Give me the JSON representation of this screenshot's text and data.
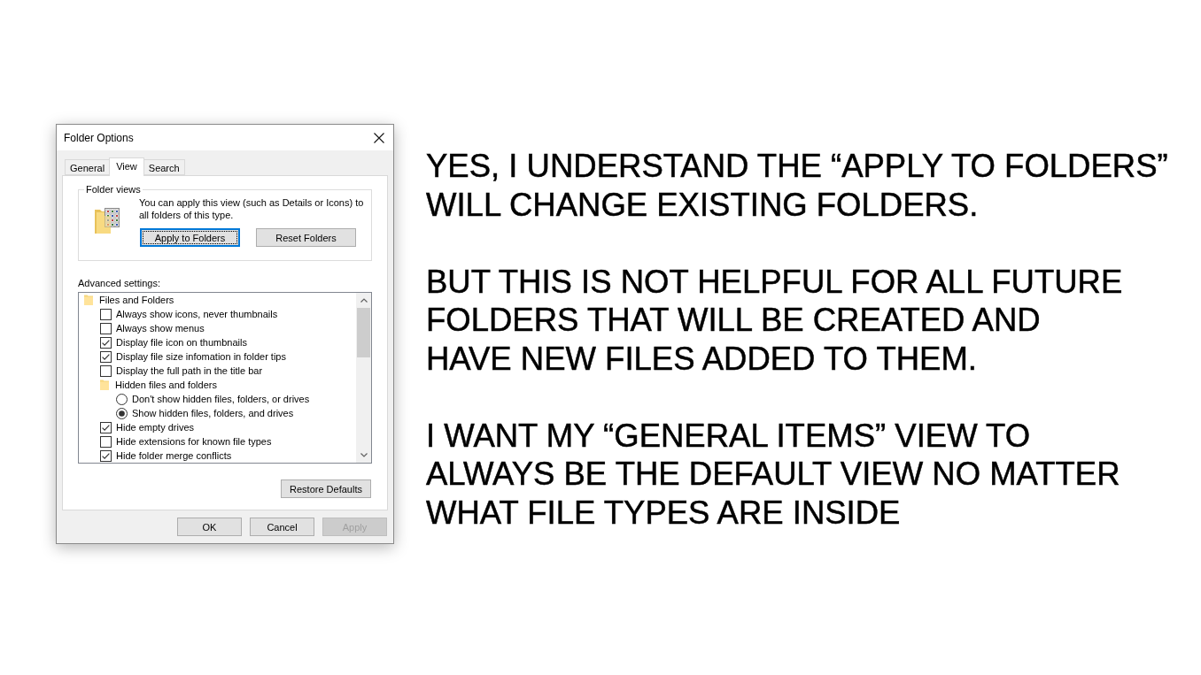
{
  "window": {
    "title": "Folder Options"
  },
  "tabs": [
    {
      "label": "General",
      "selected": false
    },
    {
      "label": "View",
      "selected": true
    },
    {
      "label": "Search",
      "selected": false
    }
  ],
  "folder_views": {
    "title": "Folder views",
    "description": "You can apply this view (such as Details or Icons) to all folders of this type.",
    "buttons": [
      {
        "label": "Apply to Folders",
        "focused": true
      },
      {
        "label": "Reset Folders",
        "focused": false
      }
    ]
  },
  "advanced_settings": {
    "label": "Advanced settings:",
    "items": [
      {
        "kind": "folder",
        "label": "Files and Folders",
        "children": [
          {
            "kind": "checkbox",
            "label": "Always show icons, never thumbnails",
            "checked": false
          },
          {
            "kind": "checkbox",
            "label": "Always show menus",
            "checked": false
          },
          {
            "kind": "checkbox",
            "label": "Display file icon on thumbnails",
            "checked": true
          },
          {
            "kind": "checkbox",
            "label": "Display file size infomation in folder tips",
            "checked": true
          },
          {
            "kind": "checkbox",
            "label": "Display the full path in the title bar",
            "checked": false
          },
          {
            "kind": "folder",
            "label": "Hidden files and folders",
            "children": [
              {
                "kind": "radio",
                "label": "Don't show hidden files, folders, or drives",
                "selected": false
              },
              {
                "kind": "radio",
                "label": "Show hidden files, folders, and drives",
                "selected": true
              }
            ]
          },
          {
            "kind": "checkbox",
            "label": "Hide empty drives",
            "checked": true
          },
          {
            "kind": "checkbox",
            "label": "Hide extensions for known file types",
            "checked": false
          },
          {
            "kind": "checkbox",
            "label": "Hide folder merge conflicts",
            "checked": true
          }
        ]
      }
    ],
    "restore_button": "Restore Defaults"
  },
  "dialog_buttons": [
    {
      "label": "OK",
      "disabled": false
    },
    {
      "label": "Cancel",
      "disabled": false
    },
    {
      "label": "Apply",
      "disabled": true
    }
  ],
  "caption": {
    "paragraphs": [
      {
        "lines": [
          "YES, I UNDERSTAND THE “APPLY TO FOLDERS”",
          "WILL CHANGE EXISTING FOLDERS."
        ]
      },
      {
        "lines": [
          "BUT THIS IS NOT HELPFUL FOR ALL FUTURE",
          "FOLDERS THAT WILL BE CREATED AND",
          "HAVE NEW FILES ADDED TO THEM."
        ]
      },
      {
        "lines": [
          "I WANT MY “GENERAL ITEMS” VIEW TO",
          "ALWAYS BE THE DEFAULT VIEW NO MATTER",
          "WHAT FILE TYPES ARE INSIDE"
        ]
      }
    ]
  }
}
